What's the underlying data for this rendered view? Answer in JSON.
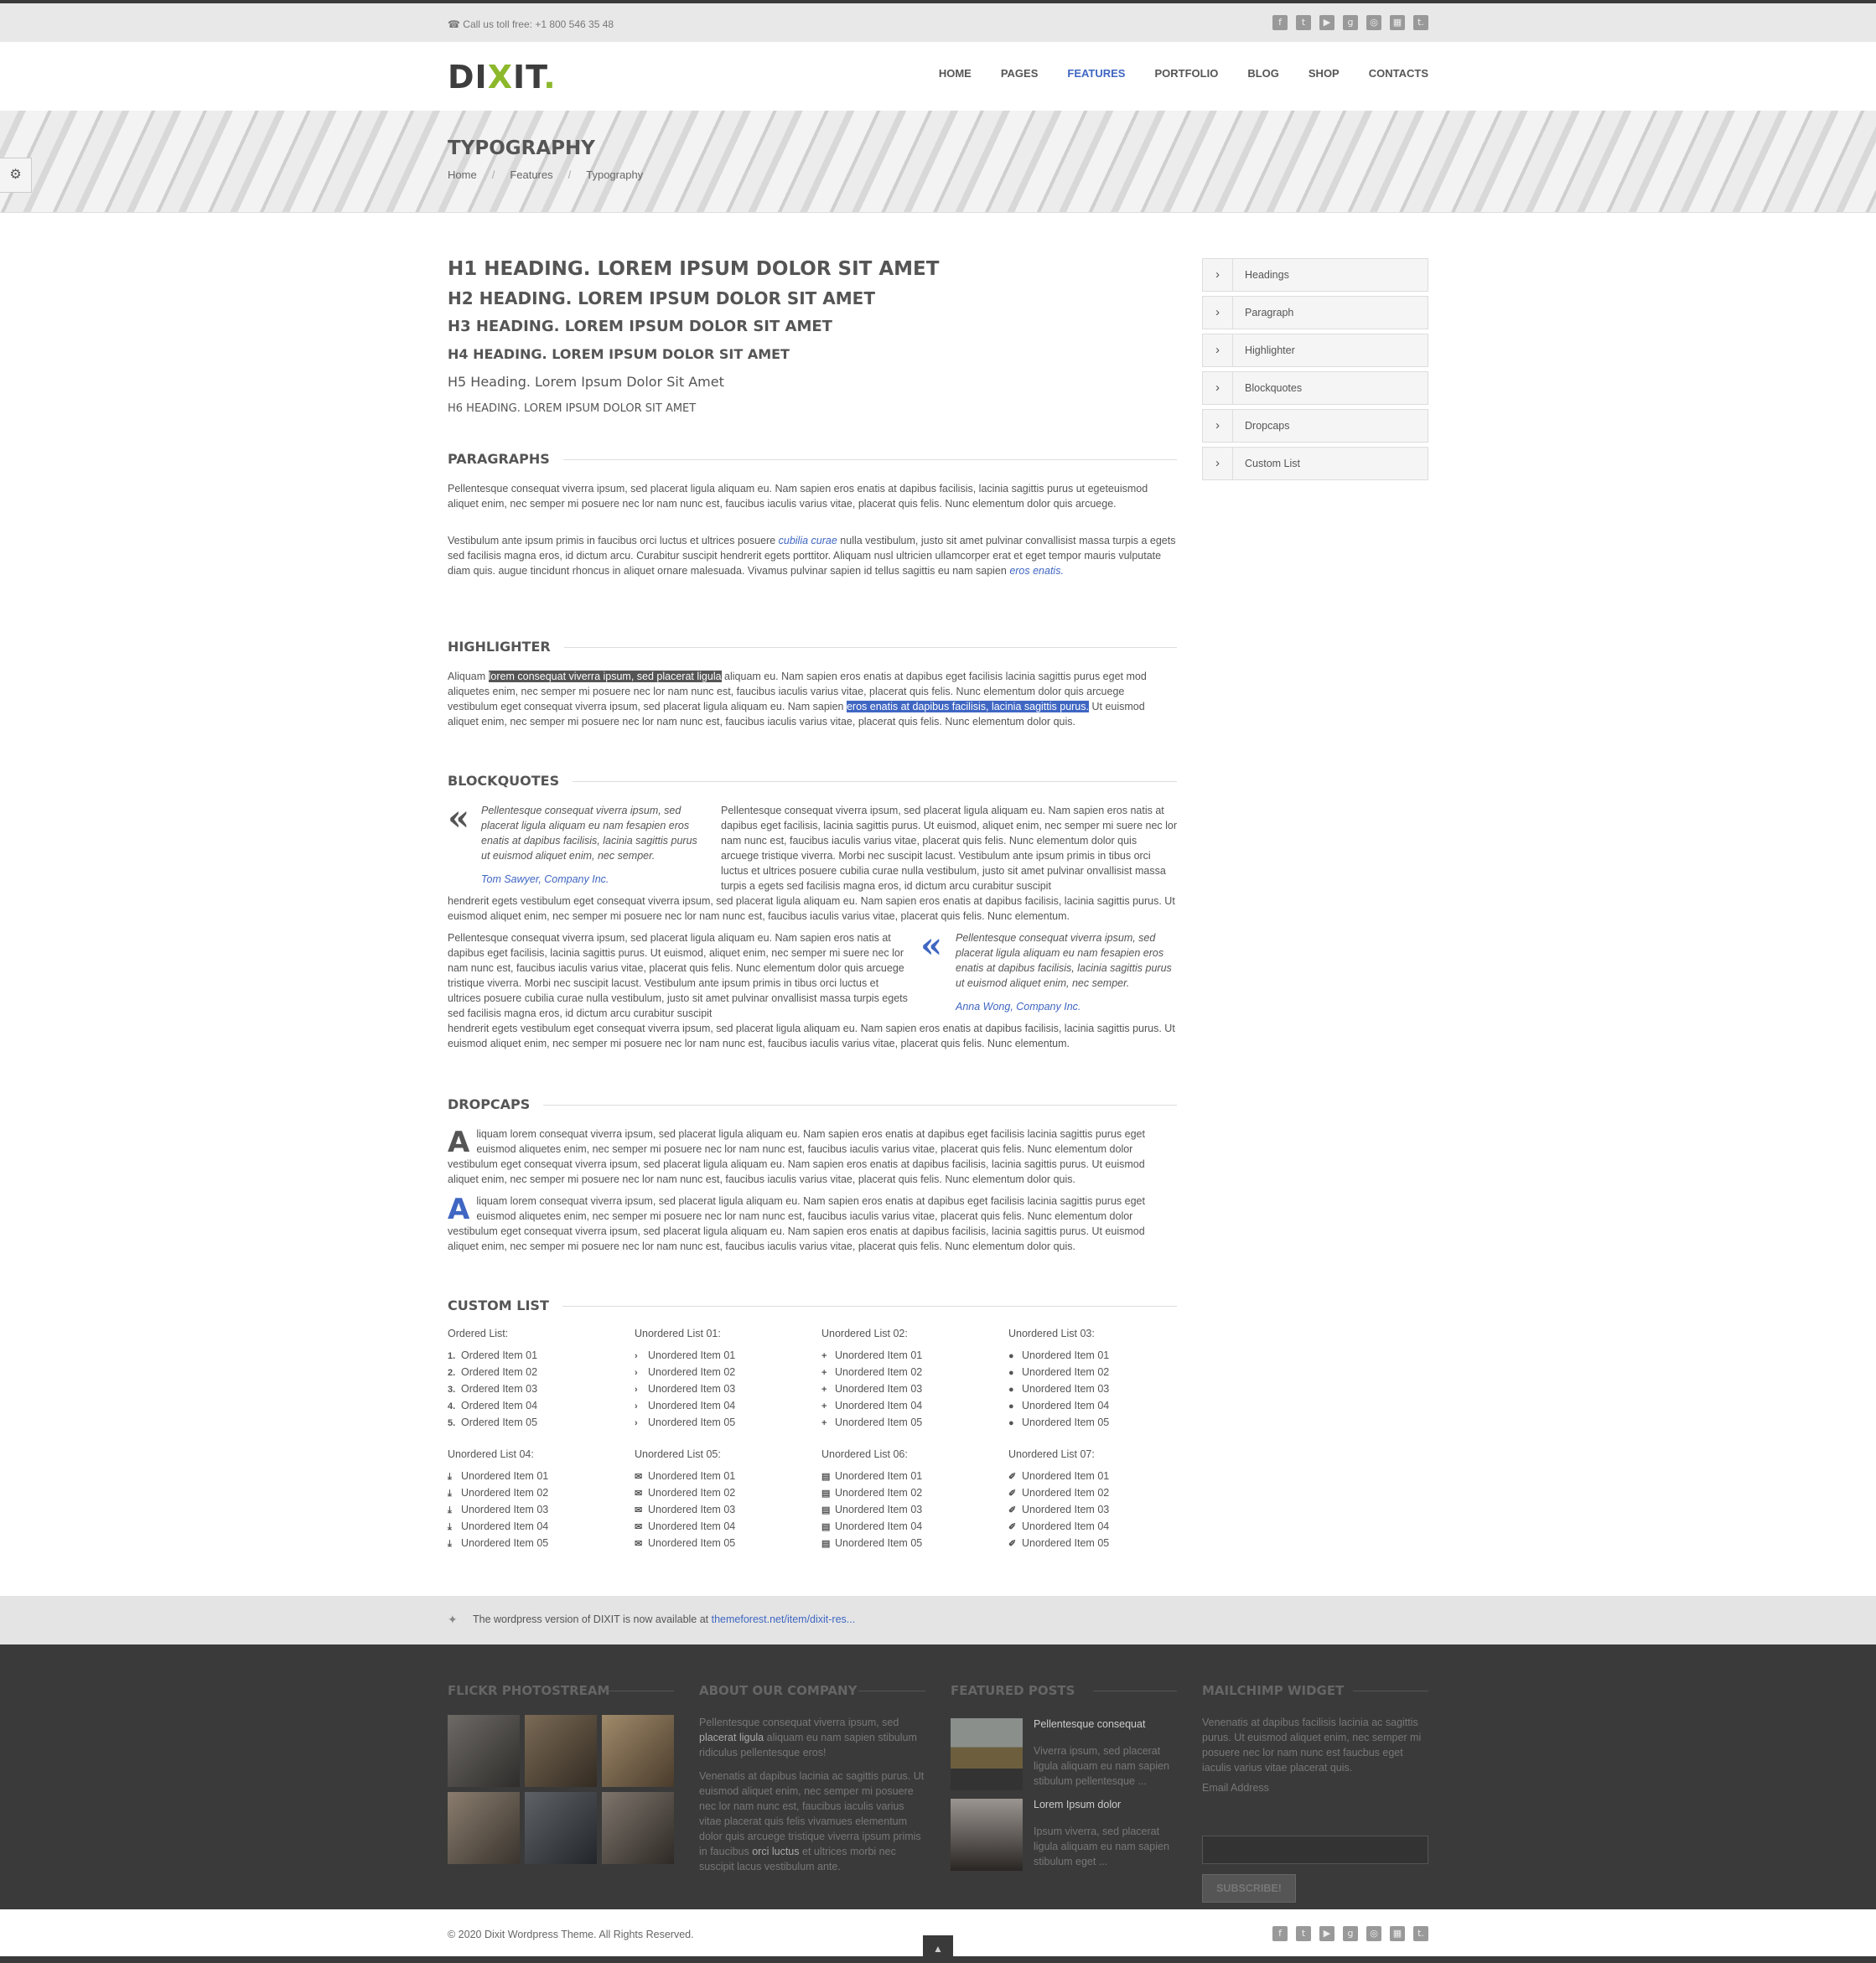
{
  "topbar": {
    "phone": "☎ Call us toll free:  +1 800 546 35 48"
  },
  "social_icons": [
    "facebook-icon",
    "twitter-icon",
    "youtube-icon",
    "google-plus-icon",
    "dribbble-icon",
    "delicious-icon",
    "tumblr-icon"
  ],
  "header": {
    "logo_main": "DI",
    "logo_x": "X",
    "logo_end": "IT",
    "logo_dot": "."
  },
  "nav": [
    "HOME",
    "PAGES",
    "FEATURES",
    "PORTFOLIO",
    "BLOG",
    "SHOP",
    "CONTACTS"
  ],
  "page": {
    "title": "TYPOGRAPHY",
    "breadcrumb": [
      "Home",
      "Features",
      "Typography"
    ],
    "crumb_sep": "/"
  },
  "headings": {
    "h1": "H1 HEADING. LOREM IPSUM DOLOR SIT AMET",
    "h2": "H2 HEADING. LOREM IPSUM DOLOR SIT AMET",
    "h3": "H3 HEADING. LOREM IPSUM DOLOR SIT AMET",
    "h4": "H4 HEADING. LOREM IPSUM DOLOR SIT AMET",
    "h5": "H5 Heading. Lorem Ipsum Dolor Sit Amet",
    "h6": "H6 HEADING. LOREM IPSUM DOLOR SIT AMET"
  },
  "paragraphs": {
    "title": "PARAGRAPHS",
    "p1": "Pellentesque consequat viverra ipsum, sed placerat ligula aliquam eu. Nam sapien eros enatis at dapibus facilisis, lacinia sagittis purus ut egeteuismod aliquet enim, nec semper mi posuere nec lor nam nunc est, faucibus iaculis varius vitae, placerat quis felis. Nunc elementum dolor quis arcuege.",
    "p2_a": "Vestibulum ante ipsum primis in faucibus orci luctus et ultrices posuere ",
    "p2_link": "cubilia curae",
    "p2_b": " nulla vestibulum, justo sit amet pulvinar convallisist massa turpis a egets sed facilisis magna eros, id dictum arcu. Curabitur suscipit hendrerit egets porttitor. Aliquam nusl ultricien ullamcorper erat et eget tempor mauris vulputate diam quis. augue tincidunt rhoncus in aliquet ornare malesuada. Vivamus pulvinar sapien id tellus sagittis eu nam sapien ",
    "p2_link2": "eros enatis."
  },
  "highlighter": {
    "title": "HIGHLIGHTER",
    "a": "Aliquam ",
    "hl1": "lorem consequat viverra ipsum, sed placerat ligula",
    "b": " aliquam eu. Nam sapien eros enatis at dapibus eget facilisis lacinia sagittis purus eget mod aliquetes enim, nec semper mi posuere nec lor nam nunc est, faucibus iaculis varius vitae, placerat quis felis. Nunc elementum dolor quis arcuege vestibulum eget consequat viverra ipsum, sed placerat ligula aliquam eu. Nam sapien ",
    "hl2": "eros enatis at dapibus facilisis, lacinia sagittis purus.",
    "c": " Ut euismod aliquet enim, nec semper mi posuere nec lor nam nunc est, faucibus iaculis varius vitae, placerat quis felis. Nunc elementum dolor quis."
  },
  "blockquotes": {
    "title": "BLOCKQUOTES",
    "mark": "«",
    "q1": "Pellentesque consequat viverra ipsum, sed placerat ligula aliquam eu nam fesapien eros enatis at dapibus facilisis, lacinia sagittis purus ut euismod aliquet enim, nec semper.",
    "q1_author": "Tom Sawyer, Company Inc.",
    "t1_side": "Pellentesque consequat viverra ipsum, sed placerat ligula aliquam eu. Nam sapien eros natis at dapibus eget facilisis, lacinia sagittis purus. Ut euismod, aliquet enim, nec semper mi suere nec lor nam nunc est, faucibus iaculis varius vitae, placerat quis felis. Nunc elementum dolor quis arcuege tristique viverra. Morbi nec suscipit lacust. Vestibulum ante ipsum primis in tibus orci luctus et ultrices posuere cubilia curae nulla vestibulum, justo sit amet pulvinar onvallisist massa turpis a egets sed facilisis magna eros, id dictum arcu curabitur suscipit",
    "t1_full": "hendrerit egets vestibulum eget consequat viverra ipsum, sed placerat ligula aliquam eu. Nam sapien eros enatis at dapibus facilisis, lacinia sagittis purus. Ut euismod aliquet enim, nec semper mi posuere nec lor nam nunc est, faucibus iaculis varius vitae, placerat quis felis. Nunc elementum.",
    "t2_side": "Pellentesque consequat viverra ipsum, sed placerat ligula aliquam eu. Nam sapien eros natis at dapibus eget facilisis, lacinia sagittis purus. Ut euismod, aliquet enim, nec semper mi suere nec lor nam nunc est, faucibus iaculis varius vitae, placerat quis felis. Nunc elementum dolor quis arcuege tristique viverra. Morbi nec suscipit lacust. Vestibulum ante ipsum primis in tibus orci luctus et ultrices posuere cubilia curae nulla vestibulum, justo sit amet pulvinar onvallisist massa turpis egets sed facilisis magna eros, id dictum arcu curabitur suscipit",
    "t2_full": "hendrerit egets vestibulum eget consequat viverra ipsum, sed placerat ligula aliquam eu. Nam sapien eros enatis at dapibus facilisis, lacinia sagittis purus. Ut euismod aliquet enim, nec semper mi posuere nec lor nam nunc est, faucibus iaculis varius vitae, placerat quis felis. Nunc elementum.",
    "q2": "Pellentesque consequat viverra ipsum, sed placerat ligula aliquam eu nam fesapien eros enatis at dapibus facilisis, lacinia sagittis purus ut euismod aliquet enim, nec semper.",
    "q2_author": "Anna Wong, Company Inc."
  },
  "dropcaps": {
    "title": "DROPCAPS",
    "letter": "A",
    "text": "liquam lorem consequat viverra ipsum, sed placerat ligula aliquam eu. Nam sapien eros enatis at dapibus eget facilisis lacinia sagittis purus eget euismod aliquetes enim, nec semper mi posuere nec lor nam nunc est, faucibus iaculis varius vitae, placerat quis felis. Nunc elementum dolor vestibulum eget consequat viverra ipsum, sed placerat ligula aliquam eu. Nam sapien eros enatis at dapibus facilisis, lacinia sagittis purus. Ut euismod aliquet enim, nec semper mi posuere nec lor nam nunc est, faucibus iaculis varius vitae, placerat quis felis. Nunc elementum dolor quis."
  },
  "custom_list": {
    "title": "CUSTOM LIST",
    "ordered_title": "Ordered List:",
    "ordered_items": [
      "Ordered Item 01",
      "Ordered Item 02",
      "Ordered Item 03",
      "Ordered Item 04",
      "Ordered Item 05"
    ],
    "ordered_nums": [
      "1.",
      "2.",
      "3.",
      "4.",
      "5."
    ],
    "unordered_titles": [
      "Unordered List 01:",
      "Unordered List 02:",
      "Unordered List 03:",
      "Unordered List 04:",
      "Unordered List 05:",
      "Unordered List 06:",
      "Unordered List 07:"
    ],
    "unordered_items": [
      "Unordered Item 01",
      "Unordered Item 02",
      "Unordered Item 03",
      "Unordered Item 04",
      "Unordered Item 05"
    ],
    "bullet_glyphs": [
      "›",
      "+",
      "●",
      "⤓",
      "✉",
      "▤",
      "✐"
    ]
  },
  "side_menu": [
    "Headings",
    "Paragraph",
    "Highlighter",
    "Blockquotes",
    "Dropcaps",
    "Custom List"
  ],
  "notice": {
    "text": "The wordpress version of DIXIT is now available at ",
    "link": "themeforest.net/item/dixit-res..."
  },
  "footer": {
    "flickr_title": "FLICKR PHOTOSTREAM",
    "about_title": "ABOUT OUR COMPANY",
    "about_p1_a": "Pellentesque consequat viverra ipsum, sed ",
    "about_p1_b": "placerat ligula",
    "about_p1_c": " aliquam eu nam sapien stibulum ridiculus pellentesque eros!",
    "about_p2_a": "Venenatis at dapibus lacinia ac sagittis purus. Ut euismod aliquet enim, nec semper mi posuere nec lor nam nunc est, faucibus iaculis varius vitae placerat quis felis vivamues elementum dolor quis arcuege tristique viverra ipsum primis in faucibus ",
    "about_p2_b": "orci luctus",
    "about_p2_c": " et ultrices morbi nec suscipit lacus vestibulum ante.",
    "posts_title": "FEATURED POSTS",
    "post1_title": "Pellentesque consequat",
    "post1_desc": "Viverra ipsum, sed placerat ligula aliquam eu nam sapien stibulum pellentesque ...",
    "post2_title": "Lorem Ipsum dolor",
    "post2_desc": "Ipsum viverra, sed placerat ligula aliquam eu nam sapien stibulum eget ...",
    "mail_title": "MAILCHIMP WIDGET",
    "mail_text": "Venenatis at dapibus facilisis lacinia ac sagittis purus. Ut euismod aliquet enim, nec semper mi posuere nec lor nam nunc est faucbus eget iaculis varius vitae placerat quis.",
    "email_label": "Email Address",
    "subscribe": "SUBSCRIBE!"
  },
  "copyright": "© 2020 Dixit Wordpress Theme. All Rights Reserved.",
  "colors": {
    "accent": "#3f66c2",
    "logo_green": "#8cb82b",
    "footer_bg": "#3a3a3a"
  }
}
